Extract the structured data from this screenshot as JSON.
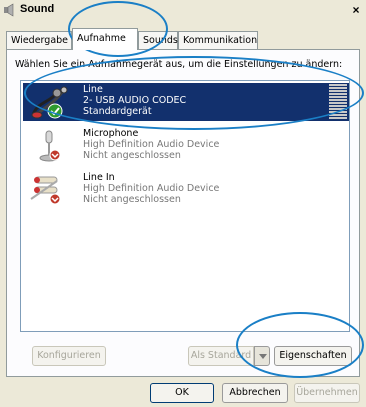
{
  "window": {
    "title": "Sound",
    "close_glyph": "×"
  },
  "tabs": [
    {
      "label": "Wiedergabe",
      "active": false
    },
    {
      "label": "Aufnahme",
      "active": true
    },
    {
      "label": "Sounds",
      "active": false
    },
    {
      "label": "Kommunikation",
      "active": false
    }
  ],
  "instruction": "Wählen Sie ein Aufnahmegerät aus, um die Einstellungen zu ändern:",
  "devices": [
    {
      "name": "Line",
      "detail": "2- USB AUDIO  CODEC",
      "status": "Standardgerät",
      "selected": true,
      "icon": "line-cable-icon",
      "badge": "default-check-icon"
    },
    {
      "name": "Microphone",
      "detail": "High Definition Audio Device",
      "status": "Nicht angeschlossen",
      "selected": false,
      "icon": "microphone-icon",
      "badge": "unplugged-icon"
    },
    {
      "name": "Line In",
      "detail": "High Definition Audio Device",
      "status": "Nicht angeschlossen",
      "selected": false,
      "icon": "line-in-cable-icon",
      "badge": "unplugged-icon"
    }
  ],
  "buttons": {
    "configure": "Konfigurieren",
    "set_default": "Als Standard",
    "properties": "Eigenschaften",
    "ok": "OK",
    "cancel": "Abbrechen",
    "apply": "Übernehmen"
  },
  "colors": {
    "selection": "#12306d",
    "annotation": "#1a7fc6",
    "window_bg": "#ece9d8"
  }
}
